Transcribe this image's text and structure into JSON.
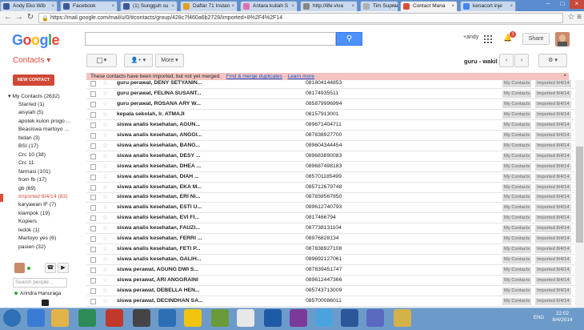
{
  "browser": {
    "tabs": [
      {
        "label": "Andy Eko Wib",
        "icon_color": "#3b5998"
      },
      {
        "label": "Facebook",
        "icon_color": "#3b5998"
      },
      {
        "label": "(1) Sungguh su",
        "icon_color": "#3b5998"
      },
      {
        "label": "Daftar 71 Instan",
        "icon_color": "#e0a020"
      },
      {
        "label": "Antara kuliah S",
        "icon_color": "#e070b0"
      },
      {
        "label": "http://life.viva",
        "icon_color": "#888888"
      },
      {
        "label": "Tim Supranati",
        "icon_color": "#b0b0b0"
      },
      {
        "label": "Contact Mana",
        "icon_color": "#dd4b39"
      },
      {
        "label": "kenacort inje",
        "icon_color": "#4285f4"
      }
    ],
    "url": "https://mail.google.com/mail/u/0/#contacts/group/428c7f460a6b2728/Imported+8%2F4%2F14"
  },
  "header": {
    "logo": "Google",
    "user_label": "+andy",
    "notification_count": "1",
    "share_label": "Share"
  },
  "toolbar": {
    "title": "Contacts",
    "more_label": "More",
    "group_name": "guru - wakil"
  },
  "notice": {
    "text": "These contacts have been imported, but not yet merged.",
    "link1": "Find & merge duplicates",
    "link2": "Learn more",
    "close": "×"
  },
  "sidebar": {
    "new_contact_label": "NEW CONTACT",
    "root": "My Contacts (2632)",
    "items": [
      "Starred (1)",
      "aisyiah (5)",
      "apotek kulon progo ...",
      "Beasiswa martoyo ...",
      "bidan (3)",
      "BSI (17)",
      "Crc 10 (38)",
      "Crc 11",
      "farmasi (101)",
      "from fb (17)",
      "gb (69)",
      "Imported 8/4/14 (83)",
      "karyawan IF (7)",
      "klampok (19)",
      "Kopiers",
      "ledok (1)",
      "Martoyo yes (6)",
      "pasien (32)"
    ],
    "selected_index": 11,
    "chat_search_placeholder": "Search people...",
    "chat_user": "Arindra Hanuraga"
  },
  "contacts": {
    "label_my_contacts": "My Contacts",
    "label_imported": "Imported 8/4/14",
    "rows": [
      {
        "name": "guru perawat, DENY SETYANIN...",
        "phone": "081804144853"
      },
      {
        "name": "guru perawat, FELINA SUSANT...",
        "phone": "08174935511"
      },
      {
        "name": "guru perawat, ROSANA ARY W...",
        "phone": "085879996994"
      },
      {
        "name": "kepala sekolah, Ir. ATMAJI",
        "phone": "08157913001"
      },
      {
        "name": "siswa analis kesehatan, AGUN...",
        "phone": "089671404711"
      },
      {
        "name": "siswa analis kesehatan, ANGGI...",
        "phone": "087838927700"
      },
      {
        "name": "siswa analis kesehatan, BANG...",
        "phone": "089604344454"
      },
      {
        "name": "siswa analis kesehatan, DESY ...",
        "phone": "089683890083"
      },
      {
        "name": "siswa analis kesehatan, DHEA ...",
        "phone": "089687498183"
      },
      {
        "name": "siswa analis kesehatan, DIAH ...",
        "phone": "085701185499"
      },
      {
        "name": "siswa analis kesehatan, EKA M...",
        "phone": "085712679748"
      },
      {
        "name": "siswa analis kesehatan, ERI NI...",
        "phone": "087838567850"
      },
      {
        "name": "siswa analis kesehatan, ESTI U...",
        "phone": "089612740793"
      },
      {
        "name": "siswa analis kesehatan, EVI FI...",
        "phone": "0817466794"
      },
      {
        "name": "siswa analis kesehatan, FAUZI...",
        "phone": "087738131104"
      },
      {
        "name": "siswa analis kesehatan, FERRI ...",
        "phone": "08976828134"
      },
      {
        "name": "siswa analis kesehatan, FETI P...",
        "phone": "087838927108"
      },
      {
        "name": "siswa analis kesehatan, GALIH...",
        "phone": "089692127061"
      },
      {
        "name": "siswa perawat, AGUNG DWI S...",
        "phone": "087839451747"
      },
      {
        "name": "siswa perawat, ARI ANGGRAINI",
        "phone": "089612447366"
      },
      {
        "name": "siswa perawat, DEBELLA HEN...",
        "phone": "085743713009"
      },
      {
        "name": "siswa perawat, DECINDHAN SA...",
        "phone": "085700086011"
      }
    ]
  },
  "taskbar": {
    "lang": "ENG",
    "time": "22:02",
    "date": "8/4/2014"
  }
}
